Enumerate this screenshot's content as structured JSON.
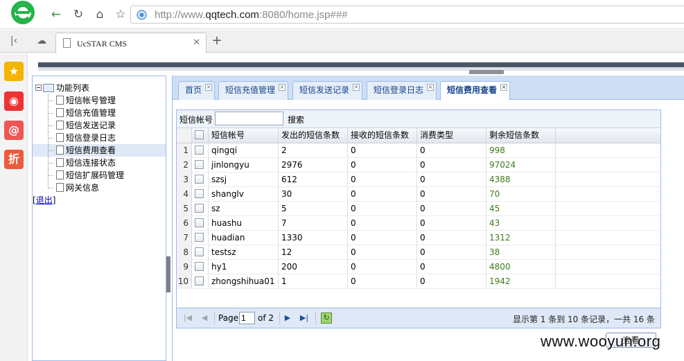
{
  "browser": {
    "url_prefix": "http://www.",
    "url_domain": "qqtech.com",
    "url_suffix": ":8080/home.jsp###",
    "tab_title": "UcSTAR CMS"
  },
  "sidebar_apps": [
    {
      "icon": "star-icon",
      "glyph": "★",
      "color": "#f4b400"
    },
    {
      "icon": "weibo-icon",
      "glyph": "◉",
      "color": "#e33"
    },
    {
      "icon": "mail-icon",
      "glyph": "@",
      "color": "#e55"
    },
    {
      "icon": "discount-icon",
      "glyph": "折",
      "color": "#ef5a3c"
    }
  ],
  "tree": {
    "root_label": "功能列表",
    "items": [
      "短信帐号管理",
      "短信充值管理",
      "短信发送记录",
      "短信登录日志",
      "短信费用查看",
      "短信连接状态",
      "短信扩展码管理",
      "网关信息"
    ],
    "selected_index": 4,
    "logout_open": "[",
    "logout_label": "退出",
    "logout_close": "]"
  },
  "tabs": [
    "首页",
    "短信充值管理",
    "短信发送记录",
    "短信登录日志",
    "短信费用查看"
  ],
  "active_tab": 4,
  "search": {
    "label": "短信帐号",
    "value": "",
    "button": "搜索"
  },
  "grid": {
    "columns": [
      "短信帐号",
      "发出的短信条数",
      "接收的短信条数",
      "消费类型",
      "剩余短信条数"
    ],
    "rows": [
      {
        "num": "1",
        "account": "qingqi",
        "sent": "2",
        "received": "0",
        "type": "0",
        "remaining": "998"
      },
      {
        "num": "2",
        "account": "jinlongyu",
        "sent": "2976",
        "received": "0",
        "type": "0",
        "remaining": "97024"
      },
      {
        "num": "3",
        "account": "szsj",
        "sent": "612",
        "received": "0",
        "type": "0",
        "remaining": "4388"
      },
      {
        "num": "4",
        "account": "shanglv",
        "sent": "30",
        "received": "0",
        "type": "0",
        "remaining": "70"
      },
      {
        "num": "5",
        "account": "sz",
        "sent": "5",
        "received": "0",
        "type": "0",
        "remaining": "45"
      },
      {
        "num": "6",
        "account": "huashu",
        "sent": "7",
        "received": "0",
        "type": "0",
        "remaining": "43"
      },
      {
        "num": "7",
        "account": "huadian",
        "sent": "1330",
        "received": "0",
        "type": "0",
        "remaining": "1312"
      },
      {
        "num": "8",
        "account": "testsz",
        "sent": "12",
        "received": "0",
        "type": "0",
        "remaining": "38"
      },
      {
        "num": "9",
        "account": "hy1",
        "sent": "200",
        "received": "0",
        "type": "0",
        "remaining": "4800"
      },
      {
        "num": "10",
        "account": "zhongshihua01",
        "sent": "1",
        "received": "0",
        "type": "0",
        "remaining": "1942"
      }
    ]
  },
  "pager": {
    "page_label": "Page",
    "current_page": "1",
    "of_label": "of 2",
    "info": "显示第 1 条到 10 条记录，一共 16 条"
  },
  "query_button": "查看",
  "watermark": "www.wooyun.org"
}
